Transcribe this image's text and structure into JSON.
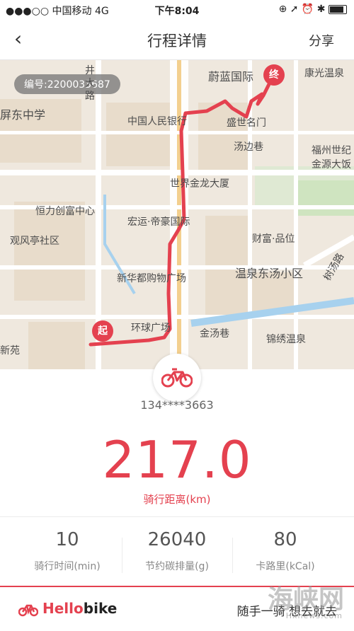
{
  "status_bar": {
    "carrier": "●●●○○ 中国移动  4G",
    "time": "下午8:04",
    "indicators": "⊕ ➚ ⏰ ✱"
  },
  "nav": {
    "back_icon": "chevron-left-icon",
    "title": "行程详情",
    "share_label": "分享"
  },
  "map": {
    "order_number": "编号:2200033687",
    "start_marker": "起",
    "end_marker": "终",
    "labels": {
      "weilan": "蔚蓝国际",
      "kangguang": "康光温泉",
      "jingzhi": "井\n大\n路",
      "pingdong": "屏东中学",
      "zgrh": "中国人民银行",
      "shengshi": "盛世名门",
      "tangbian": "汤边巷",
      "fuzhou": "福州世纪\n金源大饭",
      "sjjl": "世界金龙大厦",
      "henglion": "恒力创富中心",
      "hongyun": "宏运·帝豪国际",
      "caifu": "财富·品位",
      "guanfeng": "观风亭社区",
      "xinhuadu": "新华都购物广场",
      "wenquan": "温泉东汤小区",
      "shulin": "树汤路",
      "huanqiu": "环球广场",
      "jintang": "金汤巷",
      "jinxiu": "锦绣温泉",
      "xinyuan": "新苑"
    }
  },
  "ride": {
    "phone": "134****3663",
    "distance_value": "217.0",
    "distance_label": "骑行距离(km)"
  },
  "stats": [
    {
      "value": "10",
      "label": "骑行时间(min)"
    },
    {
      "value": "26040",
      "label": "节约碳排量(g)"
    },
    {
      "value": "80",
      "label": "卡路里(kCal)"
    }
  ],
  "footer": {
    "brand_hello": "Hello",
    "brand_bike": "bike",
    "slogan": "随手一骑 想去就去"
  },
  "watermark": {
    "main": "海峡网",
    "sub": "Hxnews.com"
  },
  "colors": {
    "accent": "#e4414f",
    "route": "#e4414f",
    "map_bg": "#efe8de"
  }
}
